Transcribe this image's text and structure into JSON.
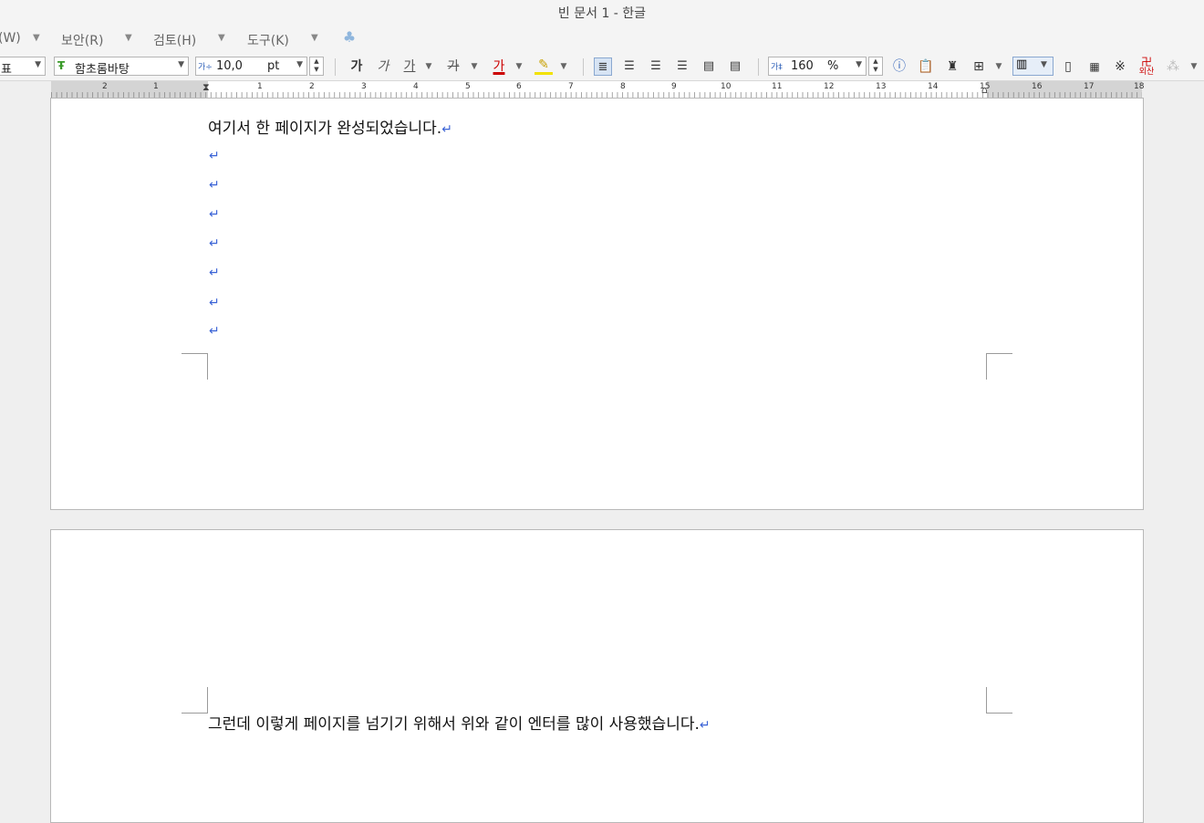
{
  "window": {
    "title": "빈 문서 1 - 한글"
  },
  "menu": {
    "items": [
      "(W)",
      "보안(R)",
      "검토(H)",
      "도구(K)"
    ]
  },
  "toolbar": {
    "style_value": "표",
    "font_value": "함초롬바탕",
    "font_size_value": "10,0",
    "font_size_unit": "pt",
    "bold": "가",
    "italic": "가",
    "underline": "가",
    "strike": "가",
    "font_color": "가",
    "line_spacing_value": "160",
    "line_spacing_unit": "%",
    "hanja": "외산"
  },
  "ruler": {
    "labels": [
      "2",
      "1",
      "1",
      "2",
      "3",
      "4",
      "5",
      "6",
      "7",
      "8",
      "9",
      "10",
      "11",
      "12",
      "13",
      "14",
      "15",
      "16",
      "17",
      "18"
    ]
  },
  "document": {
    "page1_text": "여기서 한 페이지가 완성되었습니다.",
    "page2_text": "그런데 이렇게 페이지를 넘기기 위해서 위와 같이 엔터를 많이 사용했습니다.",
    "paragraph_mark": "↵",
    "empty_paragraphs": 7
  },
  "colors": {
    "accent": "#3a63d6",
    "font_color_red": "#cc0000",
    "highlight_yellow": "#f2e200"
  }
}
